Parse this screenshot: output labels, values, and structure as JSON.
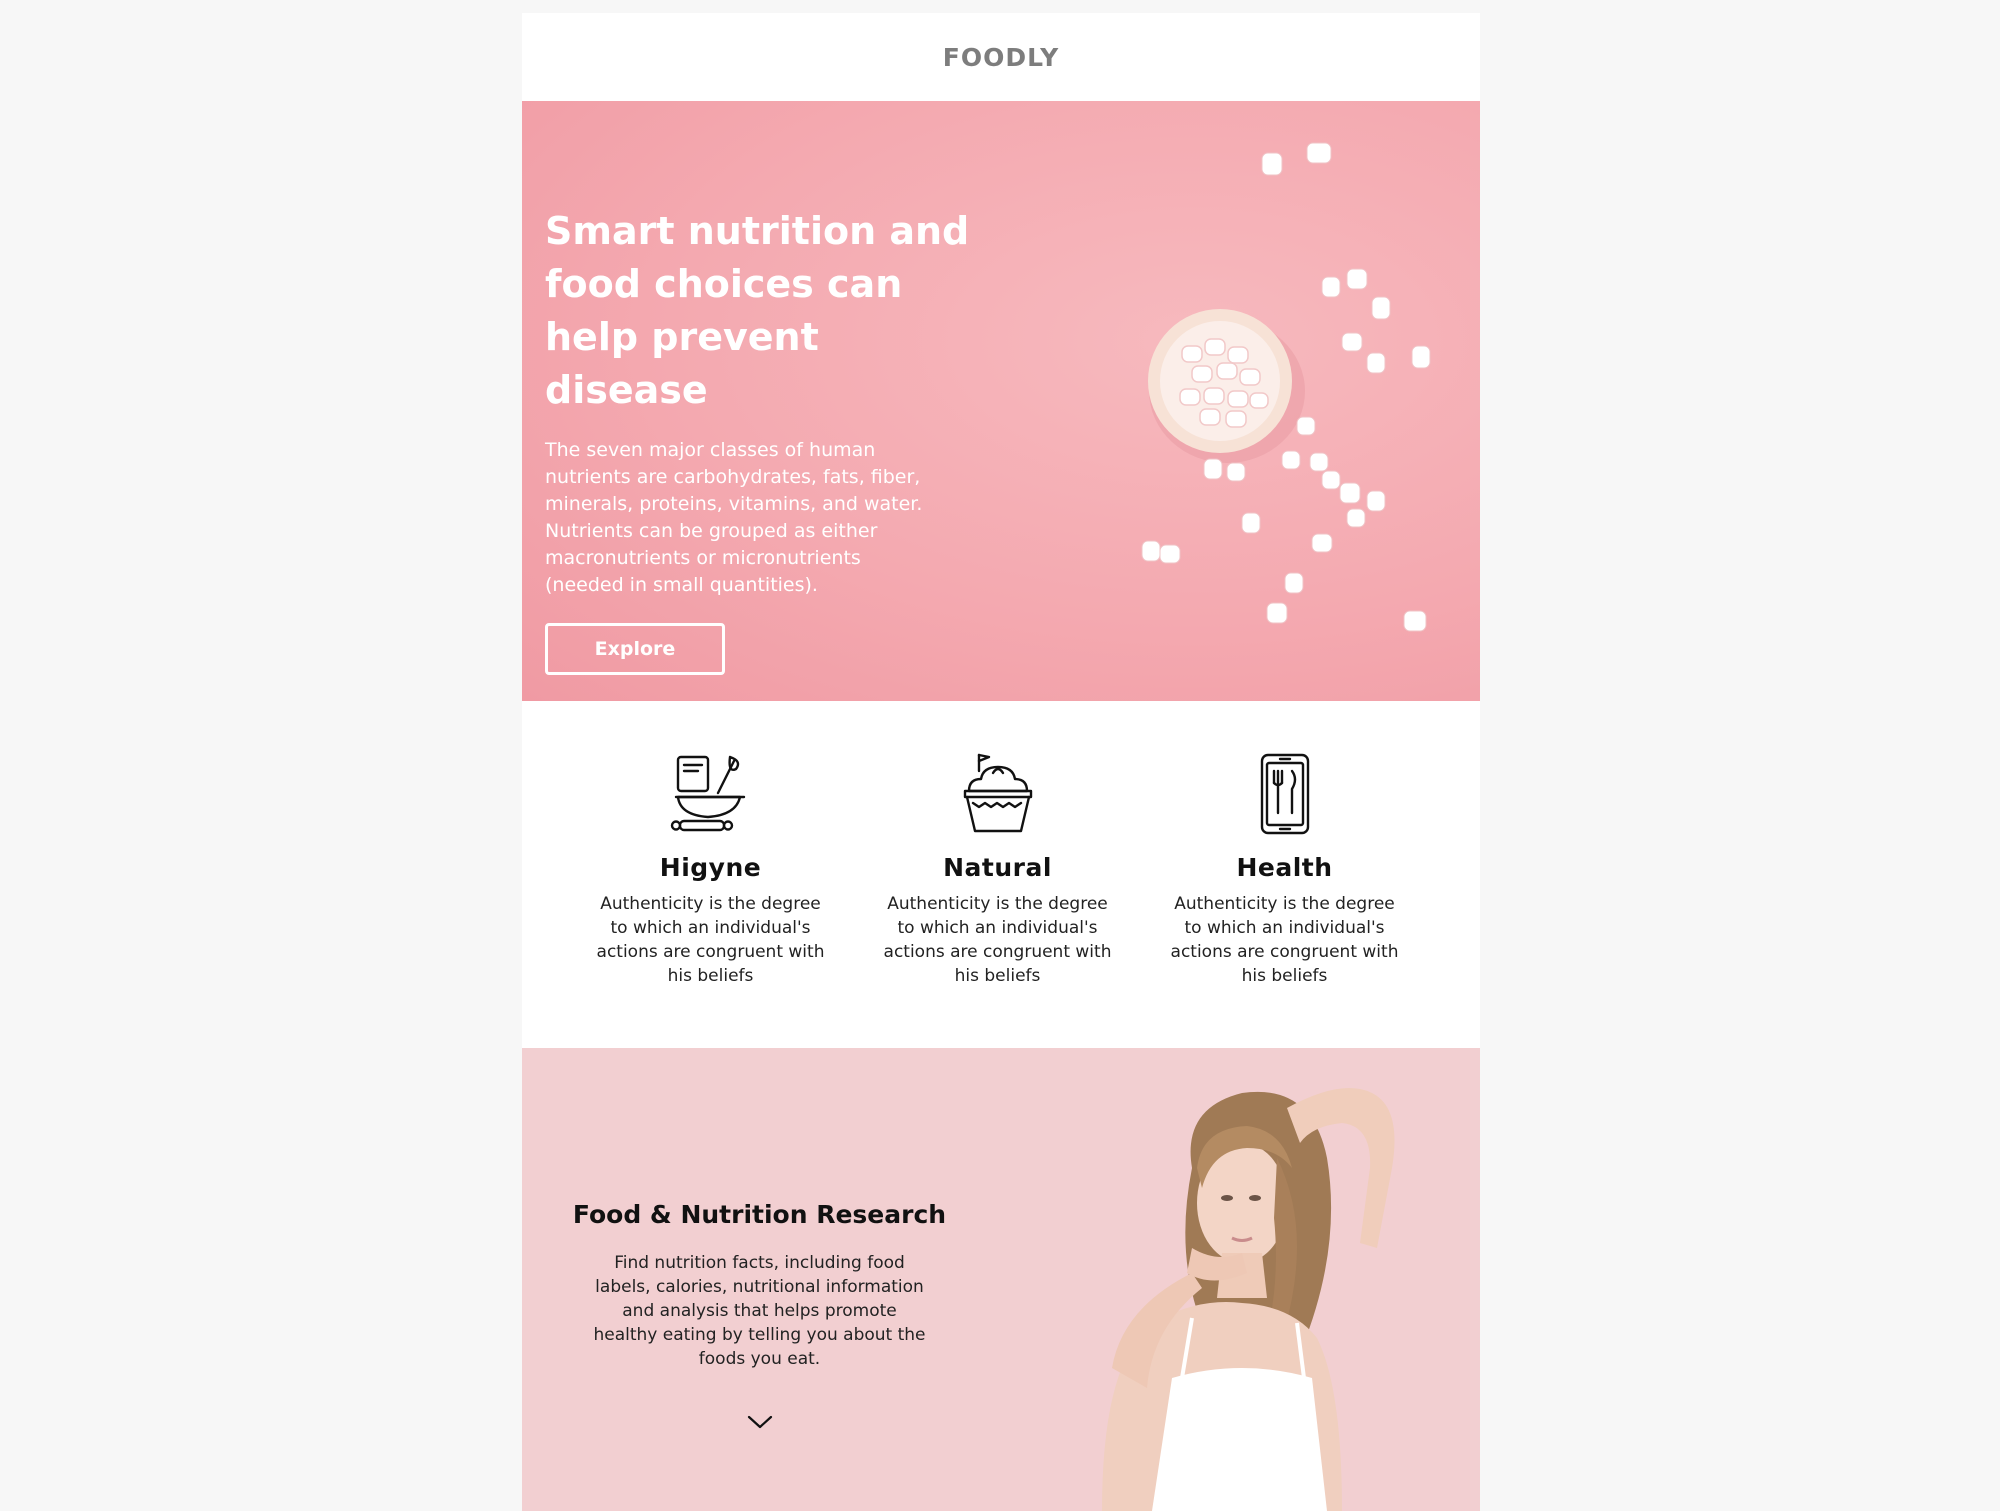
{
  "header": {
    "logo": "FOODLY"
  },
  "hero": {
    "title_lines": [
      "Smart nutrition and",
      "food choices can",
      "help prevent disease"
    ],
    "description_lines": [
      "The seven major classes of human",
      "nutrients are carbohydrates, fats, fiber,",
      "minerals, proteins, vitamins, and water.",
      "Nutrients can be grouped as either",
      "macronutrients or micronutrients",
      "(needed in small quantities)."
    ],
    "button_label": "Explore",
    "background_color": "#f4a9b0"
  },
  "features": [
    {
      "icon": "baking-bowl-whisk-icon",
      "title": "Higyne",
      "text_lines": [
        "Authenticity is the degree",
        "to which an individual's",
        "actions are congruent with",
        "his beliefs"
      ]
    },
    {
      "icon": "cupcake-icon",
      "title": "Natural",
      "text_lines": [
        "Authenticity is the degree",
        "to which an individual's",
        "actions are congruent with",
        "his beliefs"
      ]
    },
    {
      "icon": "phone-restaurant-icon",
      "title": "Health",
      "text_lines": [
        "Authenticity is the degree",
        "to which an individual's",
        "actions are congruent with",
        "his beliefs"
      ]
    }
  ],
  "research": {
    "title": "Food & Nutrition Research",
    "description_lines": [
      "Find nutrition facts, including food",
      "labels, calories, nutritional information",
      "and analysis that helps promote",
      "healthy eating by telling you about the",
      "foods you eat."
    ],
    "chevron_icon": "chevron-down-icon",
    "background_color": "#f2cfd1"
  }
}
